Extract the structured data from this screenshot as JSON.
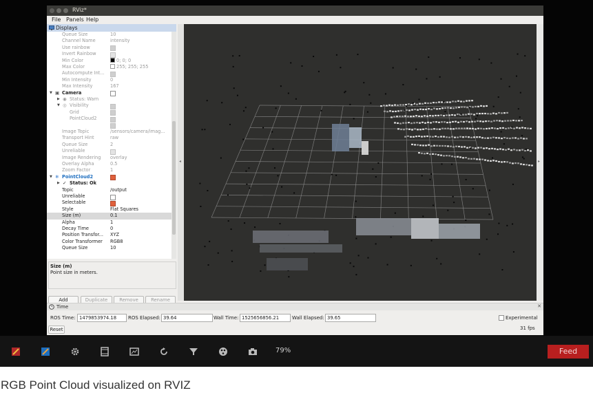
{
  "window": {
    "title": "RViz*"
  },
  "menubar": [
    "File",
    "Panels",
    "Help"
  ],
  "displays_panel": {
    "title": "Displays",
    "rows": [
      {
        "label": "Queue Size",
        "value": "10",
        "indent": 90,
        "dis": true
      },
      {
        "label": "Channel Name",
        "value": "intensity",
        "indent": 90,
        "dis": true
      },
      {
        "label": "Use rainbow",
        "check": "dis-on",
        "indent": 90,
        "dis": true
      },
      {
        "label": "Invert Rainbow",
        "check": "dis",
        "indent": 90,
        "dis": true
      },
      {
        "label": "Min Color",
        "value": "0; 0; 0",
        "swatch": "#000000",
        "indent": 90,
        "dis": true
      },
      {
        "label": "Max Color",
        "value": "255; 255; 255",
        "swatch": "#ffffff",
        "indent": 90,
        "dis": true
      },
      {
        "label": "Autocompute Int...",
        "check": "dis-on",
        "indent": 90,
        "dis": true
      },
      {
        "label": "Min Intensity",
        "value": "0",
        "indent": 90,
        "dis": true
      },
      {
        "label": "Max Intensity",
        "value": "167",
        "indent": 90,
        "dis": true
      },
      {
        "label": "Camera",
        "check": "off",
        "indent": 90,
        "bold": true,
        "arrow": "▼",
        "icon": "camera"
      },
      {
        "label": "Status: Warn",
        "indent": 101,
        "dis": true,
        "arrow": "▶",
        "icon": "warn"
      },
      {
        "label": "Visibility",
        "check": "dis-on",
        "indent": 101,
        "dis": true,
        "arrow": "▼",
        "icon": "eye"
      },
      {
        "label": "Grid",
        "check": "dis-on",
        "indent": 101,
        "dis": true
      },
      {
        "label": "PointCloud2",
        "check": "dis-on",
        "indent": 101,
        "dis": true
      },
      {
        "label": "",
        "check": "dis-on",
        "indent": 101,
        "dis": true
      },
      {
        "label": "Image Topic",
        "value": "/sensors/camera/imag...",
        "indent": 90,
        "dis": true
      },
      {
        "label": "Transport Hint",
        "value": "raw",
        "indent": 90,
        "dis": true
      },
      {
        "label": "Queue Size",
        "value": "2",
        "indent": 90,
        "dis": true
      },
      {
        "label": "Unreliable",
        "check": "dis",
        "indent": 90,
        "dis": true
      },
      {
        "label": "Image Rendering",
        "value": "overlay",
        "indent": 90,
        "dis": true
      },
      {
        "label": "Overlay Alpha",
        "value": "0.5",
        "indent": 90,
        "dis": true
      },
      {
        "label": "Zoom Factor",
        "value": "1",
        "indent": 90,
        "dis": true
      },
      {
        "label": "PointCloud2",
        "check": "on",
        "indent": 90,
        "blue": true,
        "arrow": "▼",
        "icon": "cloud"
      },
      {
        "label": "Status: Ok",
        "indent": 101,
        "bold": true,
        "arrow": "▶",
        "icon": "ok"
      },
      {
        "label": "Topic",
        "value": "/output",
        "indent": 90
      },
      {
        "label": "Unreliable",
        "check": "off",
        "indent": 90
      },
      {
        "label": "Selectable",
        "check": "on",
        "indent": 90
      },
      {
        "label": "Style",
        "value": "Flat Squares",
        "indent": 90
      },
      {
        "label": "Size (m)",
        "value": "0.1",
        "indent": 90,
        "selected": true
      },
      {
        "label": "Alpha",
        "value": "1",
        "indent": 90
      },
      {
        "label": "Decay Time",
        "value": "0",
        "indent": 90
      },
      {
        "label": "Position Transfor...",
        "value": "XYZ",
        "indent": 90
      },
      {
        "label": "Color Transformer",
        "value": "RGB8",
        "indent": 90
      },
      {
        "label": "Queue Size",
        "value": "10",
        "indent": 90
      }
    ],
    "help": {
      "title": "Size (m)",
      "description": "Point size in meters."
    },
    "buttons": {
      "add": "Add",
      "duplicate": "Duplicate",
      "remove": "Remove",
      "rename": "Rename"
    }
  },
  "time_panel": {
    "title": "Time",
    "ros_time_label": "ROS Time:",
    "ros_time": "1479853974.18",
    "ros_elapsed_label": "ROS Elapsed:",
    "ros_elapsed": "39.64",
    "wall_time_label": "Wall Time:",
    "wall_time": "1525656856.21",
    "wall_elapsed_label": "Wall Elapsed:",
    "wall_elapsed": "39.65",
    "experimental_label": "Experimental",
    "reset_label": "Reset",
    "fps": "31 fps"
  },
  "player": {
    "zoom_text": "79%",
    "feed_label": "Feed"
  },
  "caption": "RGB Point Cloud visualized on RVIZ"
}
